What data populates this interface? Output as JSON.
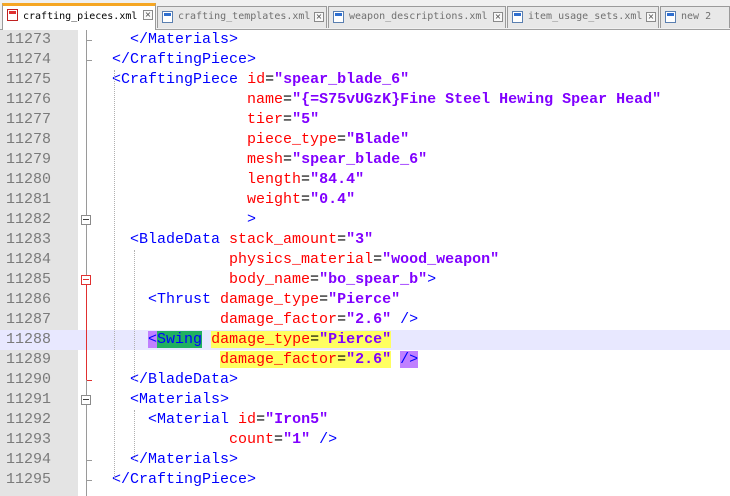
{
  "tabs": [
    {
      "label": "crafting_pieces.xml",
      "active": true,
      "modified": true
    },
    {
      "label": "crafting_templates.xml",
      "active": false,
      "modified": false
    },
    {
      "label": "weapon_descriptions.xml",
      "active": false,
      "modified": false
    },
    {
      "label": "item_usage_sets.xml",
      "active": false,
      "modified": false
    },
    {
      "label": "new 2",
      "active": false,
      "modified": false
    }
  ],
  "close_glyph": "×",
  "editor": {
    "current_line": "11288",
    "lines": [
      {
        "num": "11273",
        "indent": "    ",
        "tokens": [
          {
            "t": "tg",
            "v": "</Materials>"
          }
        ]
      },
      {
        "num": "11274",
        "indent": "  ",
        "tokens": [
          {
            "t": "tg",
            "v": "</CraftingPiece>"
          }
        ]
      },
      {
        "num": "11275",
        "indent": "  ",
        "tokens": [
          {
            "t": "tg",
            "v": "<CraftingPiece"
          },
          {
            "t": "tx",
            "v": " "
          },
          {
            "t": "at",
            "v": "id"
          },
          {
            "t": "eq",
            "v": "="
          },
          {
            "t": "vl",
            "v": "\"spear_blade_6\""
          }
        ]
      },
      {
        "num": "11276",
        "indent": "                 ",
        "tokens": [
          {
            "t": "at",
            "v": "name"
          },
          {
            "t": "eq",
            "v": "="
          },
          {
            "t": "vl",
            "v": "\"{=S75vUGzK}Fine Steel Hewing Spear Head\""
          }
        ]
      },
      {
        "num": "11277",
        "indent": "                 ",
        "tokens": [
          {
            "t": "at",
            "v": "tier"
          },
          {
            "t": "eq",
            "v": "="
          },
          {
            "t": "vl",
            "v": "\"5\""
          }
        ]
      },
      {
        "num": "11278",
        "indent": "                 ",
        "tokens": [
          {
            "t": "at",
            "v": "piece_type"
          },
          {
            "t": "eq",
            "v": "="
          },
          {
            "t": "vl",
            "v": "\"Blade\""
          }
        ]
      },
      {
        "num": "11279",
        "indent": "                 ",
        "tokens": [
          {
            "t": "at",
            "v": "mesh"
          },
          {
            "t": "eq",
            "v": "="
          },
          {
            "t": "vl",
            "v": "\"spear_blade_6\""
          }
        ]
      },
      {
        "num": "11280",
        "indent": "                 ",
        "tokens": [
          {
            "t": "at",
            "v": "length"
          },
          {
            "t": "eq",
            "v": "="
          },
          {
            "t": "vl",
            "v": "\"84.4\""
          }
        ]
      },
      {
        "num": "11281",
        "indent": "                 ",
        "tokens": [
          {
            "t": "at",
            "v": "weight"
          },
          {
            "t": "eq",
            "v": "="
          },
          {
            "t": "vl",
            "v": "\"0.4\""
          }
        ]
      },
      {
        "num": "11282",
        "indent": "                 ",
        "tokens": [
          {
            "t": "tg",
            "v": ">"
          }
        ]
      },
      {
        "num": "11283",
        "indent": "    ",
        "tokens": [
          {
            "t": "tg",
            "v": "<BladeData"
          },
          {
            "t": "tx",
            "v": " "
          },
          {
            "t": "at",
            "v": "stack_amount"
          },
          {
            "t": "eq",
            "v": "="
          },
          {
            "t": "vl",
            "v": "\"3\""
          }
        ]
      },
      {
        "num": "11284",
        "indent": "               ",
        "tokens": [
          {
            "t": "at",
            "v": "physics_material"
          },
          {
            "t": "eq",
            "v": "="
          },
          {
            "t": "vl",
            "v": "\"wood_weapon\""
          }
        ]
      },
      {
        "num": "11285",
        "indent": "               ",
        "tokens": [
          {
            "t": "at",
            "v": "body_name"
          },
          {
            "t": "eq",
            "v": "="
          },
          {
            "t": "vl",
            "v": "\"bo_spear_b\""
          },
          {
            "t": "tg",
            "v": ">"
          }
        ]
      },
      {
        "num": "11286",
        "indent": "      ",
        "tokens": [
          {
            "t": "tg",
            "v": "<Thrust"
          },
          {
            "t": "tx",
            "v": " "
          },
          {
            "t": "at",
            "v": "damage_type"
          },
          {
            "t": "eq",
            "v": "="
          },
          {
            "t": "vl",
            "v": "\"Pierce\""
          }
        ]
      },
      {
        "num": "11287",
        "indent": "              ",
        "tokens": [
          {
            "t": "at",
            "v": "damage_factor"
          },
          {
            "t": "eq",
            "v": "="
          },
          {
            "t": "vl",
            "v": "\"2.6\""
          },
          {
            "t": "tx",
            "v": " "
          },
          {
            "t": "tg",
            "v": "/>"
          }
        ]
      },
      {
        "num": "11288",
        "indent": "      ",
        "tokens": [
          {
            "t": "tg",
            "v": "<",
            "h": "lt"
          },
          {
            "t": "tg",
            "v": "Swing",
            "h": "tag"
          },
          {
            "t": "tx",
            "v": " "
          },
          {
            "t": "at",
            "v": "damage_type",
            "h": "y"
          },
          {
            "t": "eq",
            "v": "=",
            "h": "y"
          },
          {
            "t": "vl",
            "v": "\"Pierce\"",
            "h": "y"
          }
        ]
      },
      {
        "num": "11289",
        "indent": "              ",
        "tokens": [
          {
            "t": "at",
            "v": "damage_factor",
            "h": "y"
          },
          {
            "t": "eq",
            "v": "=",
            "h": "y"
          },
          {
            "t": "vl",
            "v": "\"2.6\"",
            "h": "y"
          },
          {
            "t": "tx",
            "v": " "
          },
          {
            "t": "tg",
            "v": "/>",
            "h": "lt"
          }
        ]
      },
      {
        "num": "11290",
        "indent": "    ",
        "tokens": [
          {
            "t": "tg",
            "v": "</BladeData>"
          }
        ]
      },
      {
        "num": "11291",
        "indent": "    ",
        "tokens": [
          {
            "t": "tg",
            "v": "<Materials>"
          }
        ]
      },
      {
        "num": "11292",
        "indent": "      ",
        "tokens": [
          {
            "t": "tg",
            "v": "<Material"
          },
          {
            "t": "tx",
            "v": " "
          },
          {
            "t": "at",
            "v": "id"
          },
          {
            "t": "eq",
            "v": "="
          },
          {
            "t": "vl",
            "v": "\"Iron5\""
          }
        ]
      },
      {
        "num": "11293",
        "indent": "               ",
        "tokens": [
          {
            "t": "at",
            "v": "count"
          },
          {
            "t": "eq",
            "v": "="
          },
          {
            "t": "vl",
            "v": "\"1\""
          },
          {
            "t": "tx",
            "v": " "
          },
          {
            "t": "tg",
            "v": "/>"
          }
        ]
      },
      {
        "num": "11294",
        "indent": "    ",
        "tokens": [
          {
            "t": "tg",
            "v": "</Materials>"
          }
        ]
      },
      {
        "num": "11295",
        "indent": "  ",
        "tokens": [
          {
            "t": "tg",
            "v": "</CraftingPiece>"
          }
        ]
      }
    ]
  }
}
